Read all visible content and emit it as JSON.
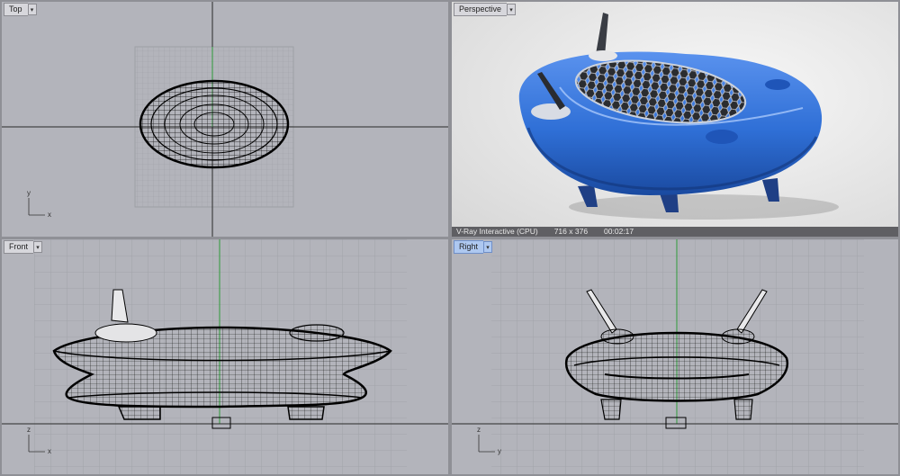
{
  "viewports": {
    "top": {
      "label": "Top"
    },
    "perspective": {
      "label": "Perspective"
    },
    "front": {
      "label": "Front"
    },
    "right": {
      "label": "Right"
    }
  },
  "render_status": {
    "engine": "V-Ray Interactive (CPU)",
    "resolution": "716 x 376",
    "elapsed": "00:02:17"
  },
  "axes": {
    "top": {
      "vertical": "y",
      "horizontal": "x"
    },
    "front": {
      "vertical": "z",
      "horizontal": "x"
    },
    "right": {
      "vertical": "z",
      "horizontal": "y"
    }
  },
  "colors": {
    "viewport_bg": "#b3b4bb",
    "grid_line": "#9c9da4",
    "axis_green": "#2c9a3a",
    "axis_dark": "#2a2a2a",
    "model_blue": "#2f6fd6",
    "active_tab": "#aec8f0"
  },
  "icons": {
    "dropdown": "chevron-down-icon"
  }
}
